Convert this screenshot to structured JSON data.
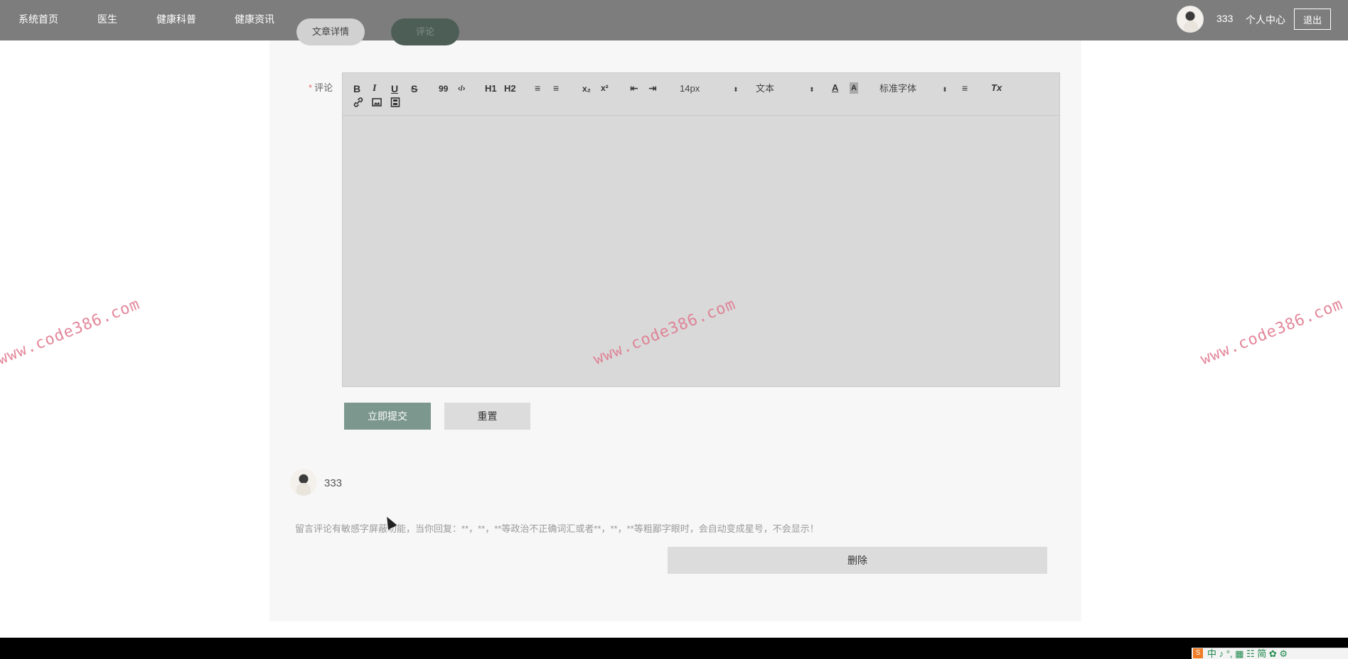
{
  "nav": {
    "items": [
      {
        "label": "系统首页"
      },
      {
        "label": "医生"
      },
      {
        "label": "健康科普"
      },
      {
        "label": "健康资讯"
      }
    ],
    "username": "333",
    "center": "个人中心",
    "logout": "退出"
  },
  "tabs": {
    "detail": "文章详情",
    "comment": "评论"
  },
  "form": {
    "required_mark": "*",
    "comment_label": "评论",
    "toolbar": {
      "bold": "B",
      "italic": "I",
      "underline": "U",
      "strike": "S",
      "blockquote": "99",
      "code": "‹/›",
      "h1": "H1",
      "h2": "H2",
      "ordered_list": "≡",
      "bullet_list": "≡",
      "subscript": "x₂",
      "superscript": "x²",
      "outdent": "⇤",
      "indent": "⇥",
      "size": "14px",
      "header": "文本",
      "color": "A",
      "background": "A",
      "font": "标准字体",
      "align": "≡",
      "clean": "Tx"
    },
    "submit": "立即提交",
    "reset": "重置"
  },
  "comments": [
    {
      "user": "333",
      "text": "留言评论有敏感字屏蔽功能，当你回复：**，**，**等政治不正确词汇或者**，**，**等粗鄙字眼时，会自动变成星号，不会显示！",
      "delete": "删除"
    }
  ],
  "watermarks": [
    "www.code386.com",
    "www.code386.com",
    "www.code386.com"
  ],
  "ime": {
    "logo": "S",
    "items": "中 ♪ °, ▦ ☷ 简 ✿ ⚙"
  },
  "colors": {
    "topbar": "#7d7d7d",
    "submit": "#7c978e",
    "tab_active": "#4c5e56",
    "watermark": "#e07a8f"
  }
}
